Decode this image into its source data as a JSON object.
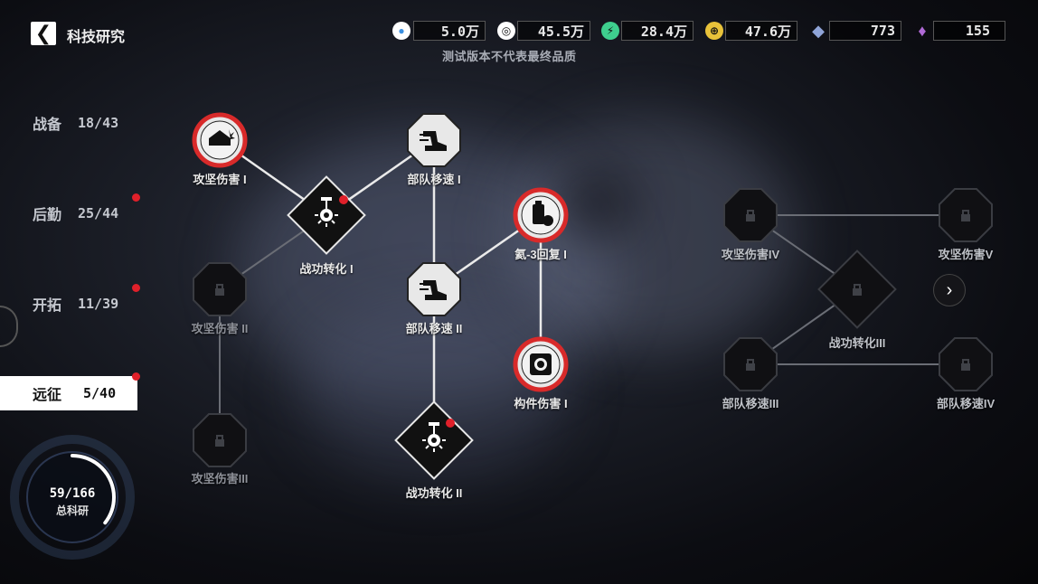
{
  "header": {
    "title": "科技研究",
    "notice": "测试版本不代表最终品质",
    "resources": [
      {
        "icon": "water-drop-icon",
        "value": "5.0万",
        "color": "#3a8fe0"
      },
      {
        "icon": "gear-ring-icon",
        "value": "45.5万",
        "color": "#ffffff"
      },
      {
        "icon": "energy-icon",
        "value": "28.4万",
        "color": "#3ecf8e"
      },
      {
        "icon": "coin-icon",
        "value": "47.6万",
        "color": "#e8c23a"
      },
      {
        "icon": "crystal-icon",
        "value": "773",
        "color": "#8fa4d8"
      },
      {
        "icon": "purple-gem-icon",
        "value": "155",
        "color": "#b06ad6"
      }
    ]
  },
  "tabs": [
    {
      "label": "战备",
      "count": "18/43",
      "active": false,
      "dot": false
    },
    {
      "label": "后勤",
      "count": "25/44",
      "active": false,
      "dot": true
    },
    {
      "label": "开拓",
      "count": "11/39",
      "active": false,
      "dot": true
    },
    {
      "label": "远征",
      "count": "5/40",
      "active": true,
      "dot": true
    }
  ],
  "total": {
    "value": "59/166",
    "label": "总科研",
    "progress": 0.355
  },
  "nodes": {
    "n1": "攻坚伤害 I",
    "n2": "部队移速 I",
    "n3": "战功转化 I",
    "n4": "氦-3回复 I",
    "n5": "攻坚伤害 II",
    "n6": "部队移速 II",
    "n7": "构件伤害 I",
    "n8": "攻坚伤害III",
    "n9": "战功转化 II",
    "n10": "攻坚伤害IV",
    "n11": "攻坚伤害V",
    "n12": "战功转化III",
    "n13": "部队移速III",
    "n14": "部队移速IV"
  },
  "colors": {
    "accent_red": "#e0202a",
    "white": "#ffffff",
    "bg": "#0c0d12"
  }
}
